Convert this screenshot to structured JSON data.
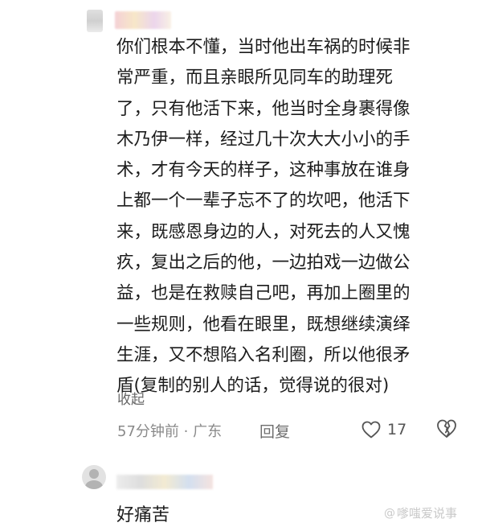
{
  "comments": [
    {
      "text": "你们根本不懂，当时他出车祸的时候非\n常严重，而且亲眼所见同车的助理死\n了，只有他活下来，他当时全身裹得像\n木乃伊一样，经过几十次大大小小的手\n术，才有今天的样子，这种事放在谁身\n上都一个一辈子忘不了的坎吧，他活下\n来，既感恩身边的人，对死去的人又愧\n疚，复出之后的他，一边拍戏一边做公\n益，也是在救赎自己吧，再加上圈里的\n一些规则，他看在眼里，既想继续演绎\n生涯，又不想陷入名利圈，所以他很矛\n盾(复制的别人的话，觉得说的很对)",
      "collapse_label": "收起",
      "meta": "57分钟前 · 广东",
      "reply_label": "回复",
      "likes": "17",
      "icons": {
        "like": "heart-outline-icon",
        "dislike": "broken-heart-icon"
      }
    },
    {
      "text": "好痛苦"
    }
  ],
  "watermark": {
    "at": "@",
    "text": "嗲嗤爱说事"
  },
  "colors": {
    "text": "#1c1c1c",
    "meta": "#8a8a8a",
    "icon": "#555555"
  }
}
